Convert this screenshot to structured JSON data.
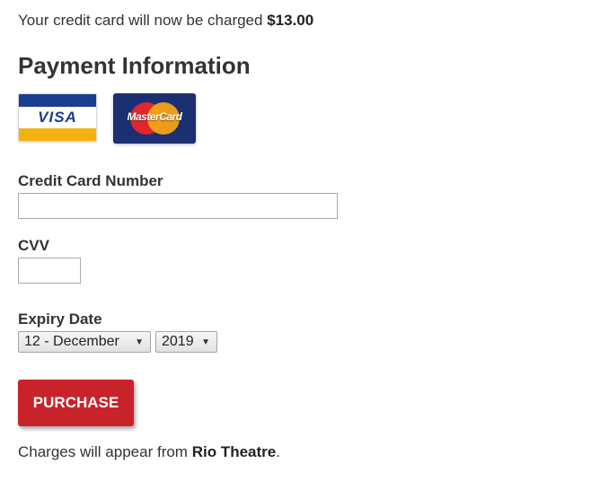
{
  "charge_notice": {
    "prefix": "Your credit card will now be charged",
    "amount": "$13.00"
  },
  "heading": "Payment Information",
  "card_logos": [
    {
      "name": "visa-logo",
      "text": "VISA"
    },
    {
      "name": "mastercard-logo",
      "text": "MasterCard"
    }
  ],
  "form": {
    "credit_card_label": "Credit Card Number",
    "credit_card_value": "",
    "cvv_label": "CVV",
    "cvv_value": "",
    "expiry_label": "Expiry Date",
    "expiry_month": "12 - December",
    "expiry_year": "2019",
    "caret_icon": "chevron-down-icon"
  },
  "purchase_button_label": "PURCHASE",
  "footer": {
    "prefix": "Charges will appear from",
    "merchant": "Rio Theatre",
    "suffix": "."
  },
  "colors": {
    "button": "#c8232b",
    "visa_blue": "#1a3d8f",
    "visa_gold": "#f2b312",
    "mc_navy": "#1b2f73",
    "mc_red": "#e3262c",
    "mc_yellow": "#f6a315"
  }
}
